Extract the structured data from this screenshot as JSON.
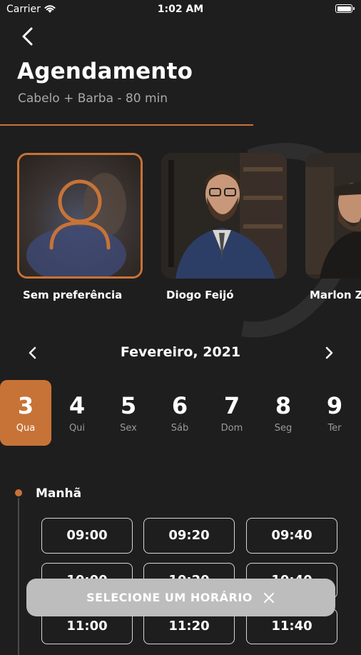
{
  "status_bar": {
    "carrier": "Carrier",
    "time": "1:02 AM"
  },
  "header": {
    "title": "Agendamento",
    "subtitle": "Cabelo + Barba - 80 min"
  },
  "professionals": [
    {
      "name": "Sem preferência",
      "selected": true
    },
    {
      "name": "Diogo Feijó",
      "selected": false
    },
    {
      "name": "Marlon Zi",
      "selected": false
    }
  ],
  "calendar": {
    "month_label": "Fevereiro, 2021",
    "days": [
      {
        "num": "3",
        "name": "Qua",
        "selected": true
      },
      {
        "num": "4",
        "name": "Qui"
      },
      {
        "num": "5",
        "name": "Sex"
      },
      {
        "num": "6",
        "name": "Sáb"
      },
      {
        "num": "7",
        "name": "Dom"
      },
      {
        "num": "8",
        "name": "Seg"
      },
      {
        "num": "9",
        "name": "Ter"
      }
    ]
  },
  "schedule": {
    "period_label": "Manhã",
    "slots": [
      "09:00",
      "09:20",
      "09:40",
      "10:00",
      "10:20",
      "10:40",
      "11:00",
      "11:20",
      "11:40"
    ]
  },
  "toast": {
    "text": "SELECIONE UM HORÁRIO"
  },
  "colors": {
    "accent": "#c77338",
    "background": "#1f1e1e"
  }
}
